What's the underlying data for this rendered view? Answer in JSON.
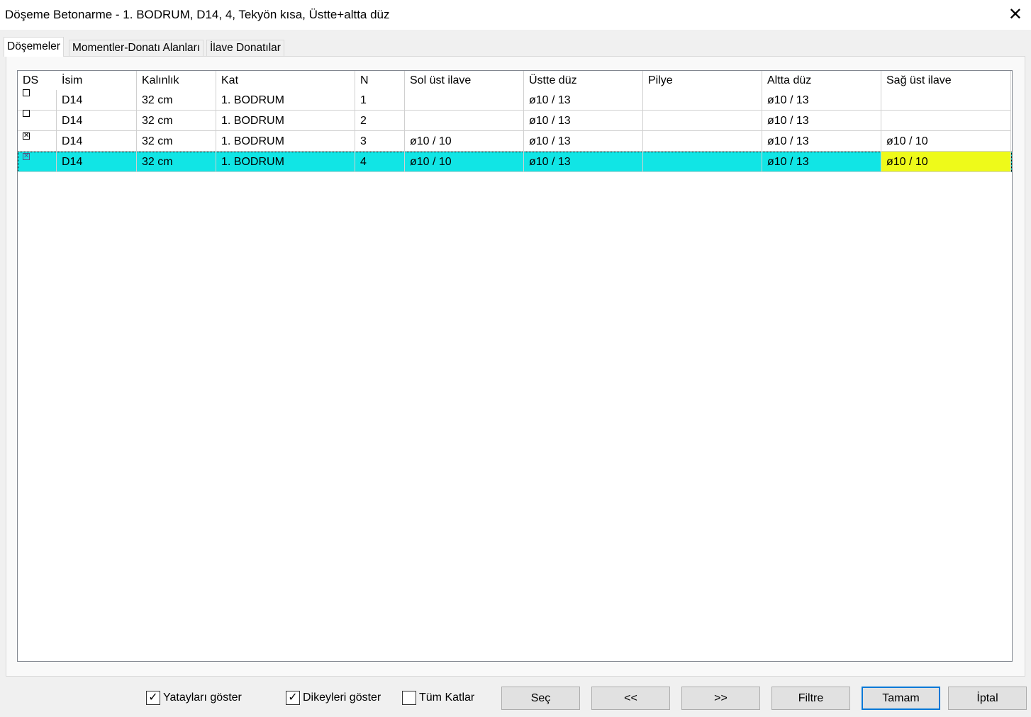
{
  "window": {
    "title": "Döşeme Betonarme - 1. BODRUM, D14, 4, Tekyön kısa, Üstte+altta düz",
    "close": "✕"
  },
  "tabs": [
    "Döşemeler",
    "Momentler-Donatı Alanları",
    "İlave Donatılar"
  ],
  "table": {
    "columns": [
      "DS",
      "İsim",
      "Kalınlık",
      "Kat",
      "N",
      "Sol üst ilave",
      "Üstte düz",
      "Pilye",
      "Altta düz",
      "Sağ üst ilave"
    ],
    "rows": [
      {
        "ds": "",
        "cells": [
          "D14",
          "32 cm",
          "1. BODRUM",
          "1",
          "",
          "ø10 / 13",
          "",
          "ø10 / 13",
          ""
        ]
      },
      {
        "ds": "",
        "cells": [
          "D14",
          "32 cm",
          "1. BODRUM",
          "2",
          "",
          "ø10 / 13",
          "",
          "ø10 / 13",
          ""
        ]
      },
      {
        "ds": "✕",
        "cells": [
          "D14",
          "32 cm",
          "1. BODRUM",
          "3",
          "ø10 / 10",
          "ø10 / 13",
          "",
          "ø10 / 13",
          "ø10 / 10"
        ]
      },
      {
        "ds": "✕",
        "cells": [
          "D14",
          "32 cm",
          "1. BODRUM",
          "4",
          "ø10 / 10",
          "ø10 / 13",
          "",
          "ø10 / 13",
          "ø10 / 10"
        ]
      }
    ],
    "selected_row": 3,
    "colors": {
      "selected": "#11e5e5",
      "highlight": "#eefa1a"
    }
  },
  "options": [
    {
      "label": "Yatayları göster",
      "checked": true,
      "mark": "✓"
    },
    {
      "label": "Dikeyleri göster",
      "checked": true,
      "mark": "✓"
    },
    {
      "label": "Tüm Katlar",
      "checked": false,
      "mark": ""
    }
  ],
  "buttons": [
    "Seç",
    "<<",
    ">>",
    "Filtre",
    "Tamam",
    "İptal"
  ]
}
